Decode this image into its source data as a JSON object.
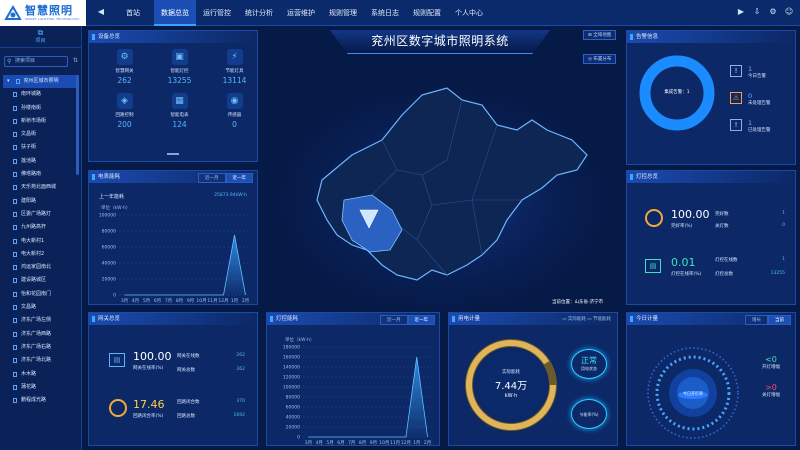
{
  "brand": {
    "name": "智慧照明",
    "subtitle": "SMART LIGHTING TECHNOLOGY"
  },
  "nav": [
    "首站",
    "数据总览",
    "运行管控",
    "统计分析",
    "运营维护",
    "规则管理",
    "系统日志",
    "规则配置",
    "个人中心"
  ],
  "nav_active": 1,
  "sidebar": {
    "title": "项目",
    "search_placeholder": "搜索项目",
    "root": "兖州区城市照明",
    "items": [
      "南环城路",
      "孙楼南街",
      "新桥市场街",
      "文昌街",
      "扶子街",
      "莲池路",
      "佛塔路南",
      "天乐苑北面西城",
      "建阳路",
      "区委广场路灯",
      "九州路高杆",
      "电大新村1",
      "电大新村2",
      "鸿运家园南北",
      "建设路城区",
      "怡和花园南门",
      "文昌路",
      "济东广场左侧",
      "济东广场西路",
      "济东广场右路",
      "济东广场北路",
      "木木路",
      "蒲花路",
      "鹏程成光路"
    ]
  },
  "device": {
    "title": "设备总览",
    "items": [
      {
        "label": "智慧网关",
        "value": "262",
        "icon": "gateway-icon",
        "glyph": "⚙"
      },
      {
        "label": "智能灯控",
        "value": "13255",
        "icon": "lamp-control-icon",
        "glyph": "▣"
      },
      {
        "label": "节能灯具",
        "value": "13114",
        "icon": "energy-lamp-icon",
        "glyph": "⚡"
      },
      {
        "label": "回路控制",
        "value": "200",
        "icon": "loop-control-icon",
        "glyph": "◈"
      },
      {
        "label": "智能电表",
        "value": "124",
        "icon": "smart-meter-icon",
        "glyph": "▦"
      },
      {
        "label": "传感器",
        "value": "0",
        "icon": "sensor-icon",
        "glyph": "◉"
      }
    ]
  },
  "center": {
    "title": "兖州区数字城市照明系统",
    "btn_full": "全域地图",
    "btn_dist": "布置分布",
    "location": "当前位置：山东省-济宁市"
  },
  "alarm": {
    "title": "告警信息",
    "ring_label": "集成告警：1",
    "rows": [
      {
        "num": "1",
        "label": "今日告警",
        "icon": "info-icon",
        "glyph": "!"
      },
      {
        "num": "0",
        "label": "未处理告警",
        "icon": "warning-icon",
        "glyph": "⚠"
      },
      {
        "num": "1",
        "label": "已处理告警",
        "icon": "info-icon",
        "glyph": "!"
      }
    ]
  },
  "energy": {
    "title": "电表能耗",
    "tabs": [
      "近一月",
      "近一年"
    ],
    "active_tab": 1,
    "sub_label": "上一年能耗",
    "sub_value": "25873.94kW·h",
    "unit": "单位（kW·h）",
    "chart_data": {
      "type": "area",
      "categories": [
        "3月",
        "4月",
        "5月",
        "6月",
        "7月",
        "8月",
        "9月",
        "10月",
        "11月",
        "12月",
        "1月",
        "2月"
      ],
      "values": [
        0,
        0,
        0,
        0,
        0,
        0,
        0,
        0,
        0,
        0,
        75000,
        0
      ],
      "yticks": [
        0,
        20000,
        40000,
        60000,
        80000,
        100000
      ],
      "ylabel": "单位（kW·h）",
      "ylim": [
        0,
        100000
      ]
    }
  },
  "lamp": {
    "title": "灯控总览",
    "pct1": "100.00",
    "pct1_label": "完好率(%)",
    "a_label": "完好数",
    "a_value": "1",
    "b_label": "关灯数",
    "b_value": "0",
    "pct2": "0.01",
    "pct2_label": "灯控在线率(%)",
    "c_label": "灯控在线数",
    "c_value": "1",
    "d_label": "灯控总数",
    "d_value": "13255"
  },
  "gateway": {
    "title": "网关总览",
    "pct1": "100.00",
    "pct1_label": "网关在线率(%)",
    "a_label": "网关在线数",
    "a_value": "262",
    "b_label": "网关总数",
    "b_value": "262",
    "pct2": "17.46",
    "pct2_label": "回路闭合率(%)",
    "c_label": "回路闭合数",
    "c_value": "370",
    "d_label": "回路总数",
    "d_value": "1692"
  },
  "lampenergy": {
    "title": "灯控能耗",
    "tabs": [
      "近一月",
      "近一年"
    ],
    "active_tab": 1,
    "unit": "单位（kW·h）",
    "chart_data": {
      "type": "area",
      "categories": [
        "3月",
        "4月",
        "5月",
        "6月",
        "7月",
        "8月",
        "9月",
        "10月",
        "11月",
        "12月",
        "1月",
        "2月"
      ],
      "values": [
        0,
        0,
        0,
        0,
        0,
        0,
        0,
        0,
        0,
        0,
        160000,
        0
      ],
      "yticks": [
        0,
        20000,
        40000,
        60000,
        80000,
        100000,
        120000,
        140000,
        160000,
        180000
      ],
      "ylabel": "单位（kW·h）",
      "ylim": [
        0,
        180000
      ]
    }
  },
  "usage": {
    "title": "用电计量",
    "legend": [
      "实际能耗",
      "节能能耗"
    ],
    "center_label": "实际能耗",
    "center_value": "7.44万",
    "center_unit": "kW·h",
    "status": "正常",
    "status_label": "用电状态",
    "save_label": "节能率(%)"
  },
  "today": {
    "title": "今日计量",
    "tabs": [
      "增长",
      "当前"
    ],
    "gauge_label": "今日开灯率",
    "open": "<0",
    "open_label": "开灯增幅",
    "close": ">0",
    "close_label": "关灯增幅"
  },
  "colors": {
    "accent": "#3fa7ff",
    "bg": "#061a47",
    "warning": "#ff9b3b"
  }
}
